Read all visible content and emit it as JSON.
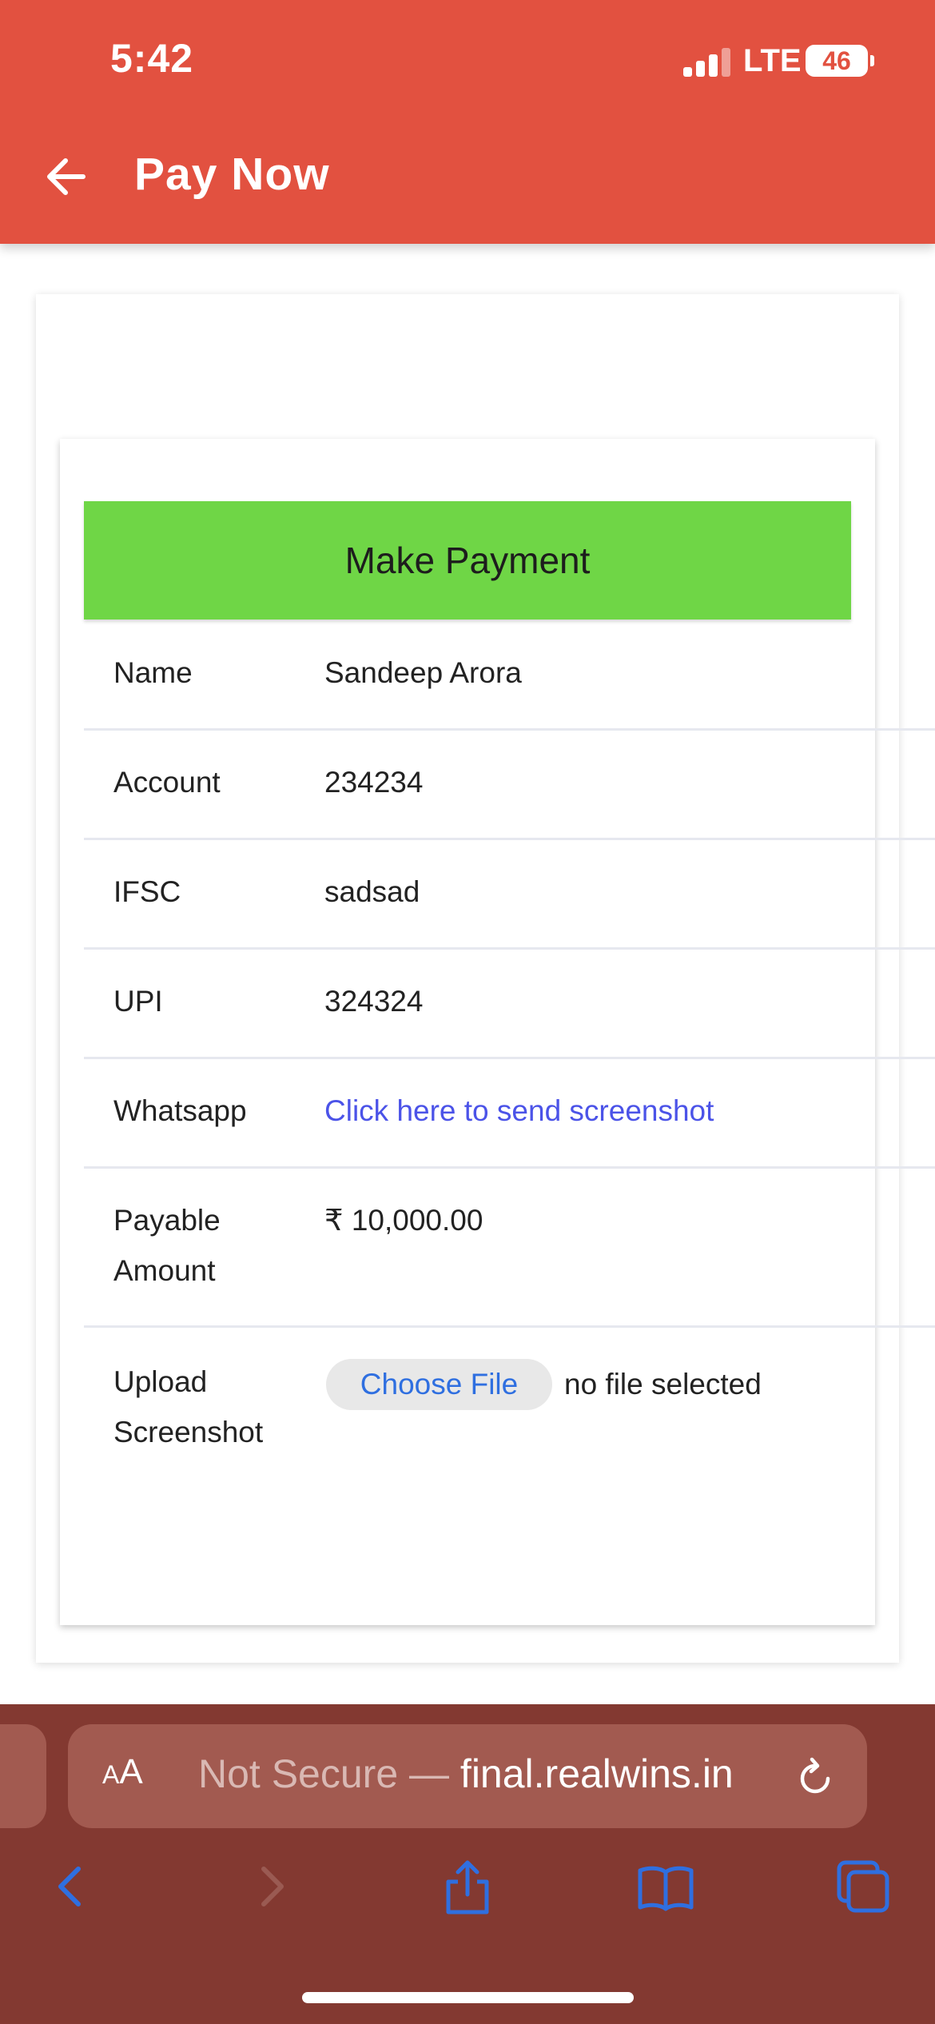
{
  "status_bar": {
    "time": "5:42",
    "network": "LTE",
    "battery": "46"
  },
  "app_bar": {
    "title": "Pay Now",
    "back_icon": "arrow-left-icon"
  },
  "payment": {
    "banner": "Make Payment",
    "rows": [
      {
        "label": "Name",
        "value": "Sandeep Arora"
      },
      {
        "label": "Account",
        "value": "234234"
      },
      {
        "label": "IFSC",
        "value": "sadsad"
      },
      {
        "label": "UPI",
        "value": "324324"
      },
      {
        "label": "Whatsapp",
        "value": "Click here to send screenshot"
      },
      {
        "label": "Payable Amount",
        "value": "₹ 10,000.00"
      },
      {
        "label": "Upload Screenshot",
        "button": "Choose File",
        "status": "no file selected"
      }
    ]
  },
  "browser": {
    "aa_label": "AA",
    "security": "Not Secure —",
    "domain": "final.realwins.in",
    "accent_color": "#2f6fe0",
    "toolbar_color": "#833931",
    "icons": [
      "back-icon",
      "forward-icon",
      "share-icon",
      "bookmarks-icon",
      "tabs-icon",
      "reload-icon"
    ]
  },
  "colors": {
    "app_bar": "#e25140",
    "banner": "#6fd646",
    "link": "#4b53e8"
  }
}
